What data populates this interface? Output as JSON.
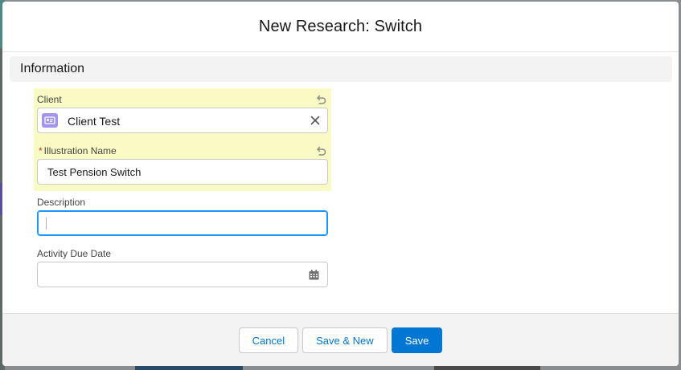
{
  "modal": {
    "title": "New Research: Switch"
  },
  "section": {
    "title": "Information"
  },
  "fields": {
    "client": {
      "label": "Client",
      "value": "Client Test"
    },
    "illustration_name": {
      "required_marker": "*",
      "label": "Illustration Name",
      "value": "Test Pension Switch"
    },
    "description": {
      "label": "Description",
      "value": ""
    },
    "activity_due_date": {
      "label": "Activity Due Date",
      "value": ""
    }
  },
  "footer": {
    "cancel_label": "Cancel",
    "save_new_label": "Save & New",
    "save_label": "Save"
  },
  "icons": {
    "undo": "undo-icon",
    "lookup": "contact-card-icon",
    "clear": "close-icon",
    "calendar": "calendar-icon"
  },
  "colors": {
    "brand": "#0176d3",
    "highlight": "#f9fac4",
    "lookup_icon": "#a094ed",
    "focus": "#1b96ff"
  }
}
